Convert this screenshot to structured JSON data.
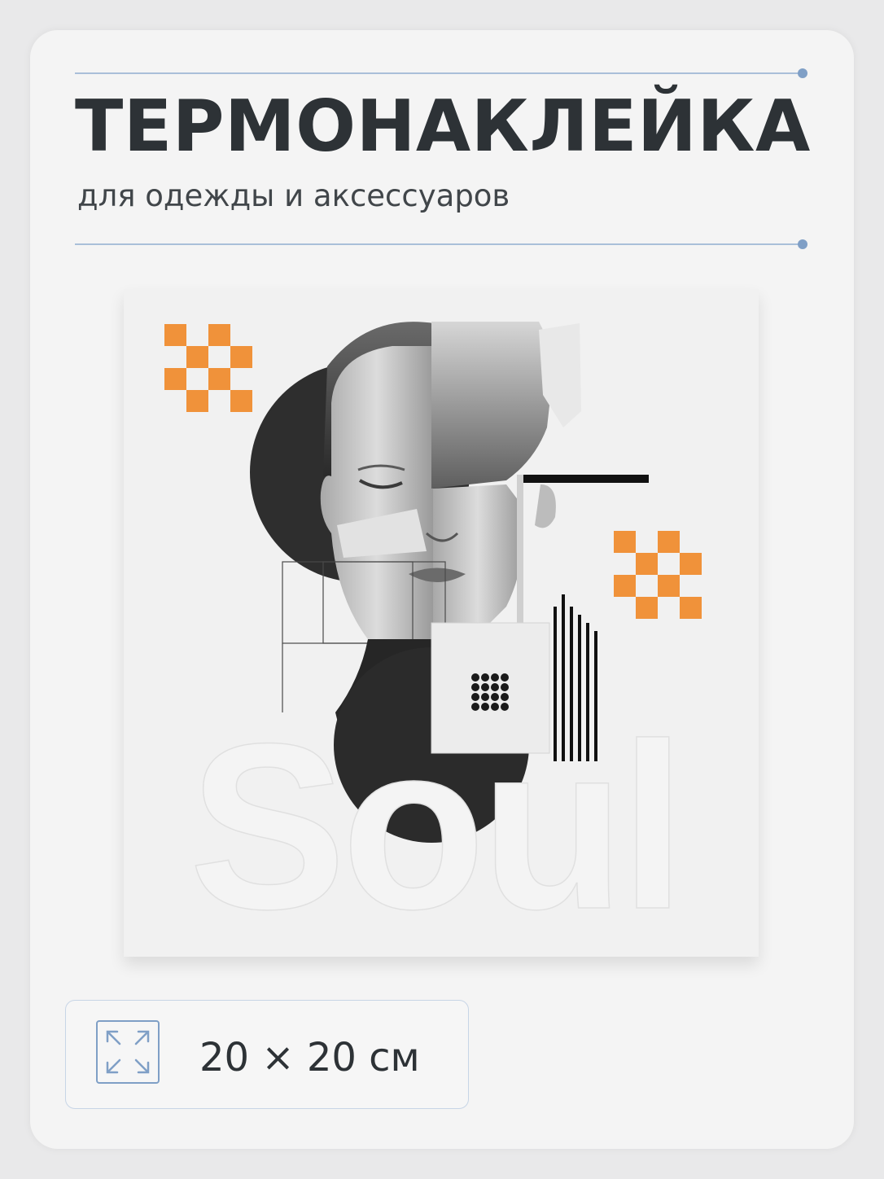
{
  "header": {
    "title": "ТЕРМОНАКЛЕЙКА",
    "subtitle": "для одежды и аксессуаров"
  },
  "artwork": {
    "word": "Soul"
  },
  "size": {
    "value": "20 × 20",
    "unit": "см",
    "icon": "expand-arrows-icon"
  },
  "colors": {
    "title": "#2d3236",
    "accent_rule": "#a9bfd9",
    "accent_dot": "#7f9fc6",
    "orange": "#f0923a"
  }
}
